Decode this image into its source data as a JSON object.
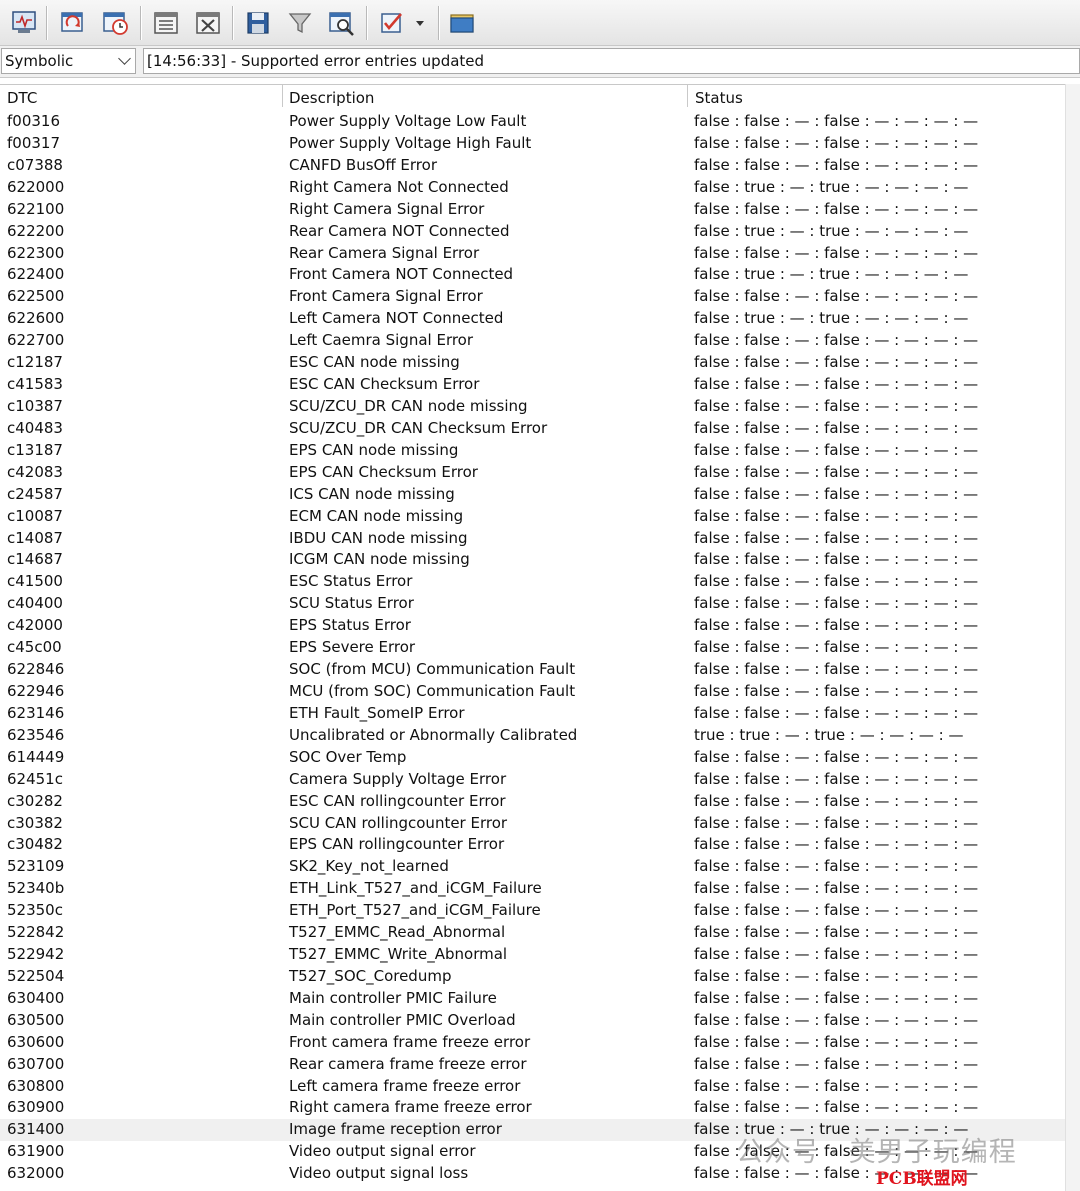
{
  "toolbar": {
    "buttons": [
      {
        "name": "display-icon"
      },
      {
        "name": "refresh-icon"
      },
      {
        "name": "refresh-clock-icon"
      },
      {
        "name": "list-icon"
      },
      {
        "name": "clear-list-icon"
      },
      {
        "name": "save-icon"
      },
      {
        "name": "filter-icon"
      },
      {
        "name": "search-window-icon"
      },
      {
        "name": "checklist-icon"
      },
      {
        "name": "folder-icon"
      }
    ]
  },
  "filter": {
    "mode_value": "Symbolic",
    "message": "[14:56:33] - Supported error entries updated"
  },
  "table": {
    "headers": {
      "dtc": "DTC",
      "description": "Description",
      "status": "Status"
    },
    "rows": [
      {
        "dtc": "f00316",
        "description": "Power Supply Voltage Low Fault",
        "status": "false : false : — : false : — : — : — : —"
      },
      {
        "dtc": "f00317",
        "description": "Power Supply Voltage High Fault",
        "status": "false : false : — : false : — : — : — : —"
      },
      {
        "dtc": "c07388",
        "description": "CANFD BusOff Error",
        "status": "false : false : — : false : — : — : — : —"
      },
      {
        "dtc": "622000",
        "description": "Right Camera Not Connected",
        "status": "false : true : — : true : — : — : — : —"
      },
      {
        "dtc": "622100",
        "description": "Right Camera Signal Error",
        "status": "false : false : — : false : — : — : — : —"
      },
      {
        "dtc": "622200",
        "description": "Rear Camera NOT Connected",
        "status": "false : true : — : true : — : — : — : —"
      },
      {
        "dtc": "622300",
        "description": "Rear Camera Signal Error",
        "status": "false : false : — : false : — : — : — : —"
      },
      {
        "dtc": "622400",
        "description": "Front Camera NOT Connected",
        "status": "false : true : — : true : — : — : — : —"
      },
      {
        "dtc": "622500",
        "description": "Front Camera Signal Error",
        "status": "false : false : — : false : — : — : — : —"
      },
      {
        "dtc": "622600",
        "description": "Left Camera NOT Connected",
        "status": "false : true : — : true : — : — : — : —"
      },
      {
        "dtc": "622700",
        "description": "Left Caemra Signal Error",
        "status": "false : false : — : false : — : — : — : —"
      },
      {
        "dtc": "c12187",
        "description": "ESC CAN node missing",
        "status": "false : false : — : false : — : — : — : —"
      },
      {
        "dtc": "c41583",
        "description": "ESC CAN Checksum Error",
        "status": "false : false : — : false : — : — : — : —"
      },
      {
        "dtc": "c10387",
        "description": "SCU/ZCU_DR CAN node missing",
        "status": "false : false : — : false : — : — : — : —"
      },
      {
        "dtc": "c40483",
        "description": "SCU/ZCU_DR CAN Checksum Error",
        "status": "false : false : — : false : — : — : — : —"
      },
      {
        "dtc": "c13187",
        "description": "EPS CAN node missing",
        "status": "false : false : — : false : — : — : — : —"
      },
      {
        "dtc": "c42083",
        "description": "EPS CAN Checksum Error",
        "status": "false : false : — : false : — : — : — : —"
      },
      {
        "dtc": "c24587",
        "description": "ICS CAN node missing",
        "status": "false : false : — : false : — : — : — : —"
      },
      {
        "dtc": "c10087",
        "description": "ECM CAN node missing",
        "status": "false : false : — : false : — : — : — : —"
      },
      {
        "dtc": "c14087",
        "description": "IBDU CAN node missing",
        "status": "false : false : — : false : — : — : — : —"
      },
      {
        "dtc": "c14687",
        "description": "ICGM CAN node missing",
        "status": "false : false : — : false : — : — : — : —"
      },
      {
        "dtc": "c41500",
        "description": "ESC Status Error",
        "status": "false : false : — : false : — : — : — : —"
      },
      {
        "dtc": "c40400",
        "description": "SCU Status Error",
        "status": "false : false : — : false : — : — : — : —"
      },
      {
        "dtc": "c42000",
        "description": "EPS Status Error",
        "status": "false : false : — : false : — : — : — : —"
      },
      {
        "dtc": "c45c00",
        "description": "EPS Severe Error",
        "status": "false : false : — : false : — : — : — : —"
      },
      {
        "dtc": "622846",
        "description": "SOC (from MCU) Communication Fault",
        "status": "false : false : — : false : — : — : — : —"
      },
      {
        "dtc": "622946",
        "description": "MCU (from SOC) Communication Fault",
        "status": "false : false : — : false : — : — : — : —"
      },
      {
        "dtc": "623146",
        "description": "ETH Fault_SomeIP Error",
        "status": "false : false : — : false : — : — : — : —"
      },
      {
        "dtc": "623546",
        "description": "Uncalibrated or Abnormally Calibrated",
        "status": "true : true : — : true : — : — : — : —"
      },
      {
        "dtc": "614449",
        "description": "SOC Over Temp",
        "status": "false : false : — : false : — : — : — : —"
      },
      {
        "dtc": "62451c",
        "description": "Camera  Supply Voltage Error",
        "status": "false : false : — : false : — : — : — : —"
      },
      {
        "dtc": "c30282",
        "description": "ESC CAN rollingcounter Error",
        "status": "false : false : — : false : — : — : — : —"
      },
      {
        "dtc": "c30382",
        "description": "SCU CAN rollingcounter Error",
        "status": "false : false : — : false : — : — : — : —"
      },
      {
        "dtc": "c30482",
        "description": "EPS CAN rollingcounter Error",
        "status": "false : false : — : false : — : — : — : —"
      },
      {
        "dtc": "523109",
        "description": "SK2_Key_not_learned",
        "status": "false : false : — : false : — : — : — : —"
      },
      {
        "dtc": "52340b",
        "description": "ETH_Link_T527_and_iCGM_Failure",
        "status": "false : false : — : false : — : — : — : —"
      },
      {
        "dtc": "52350c",
        "description": "ETH_Port_T527_and_iCGM_Failure",
        "status": "false : false : — : false : — : — : — : —"
      },
      {
        "dtc": "522842",
        "description": "T527_EMMC_Read_Abnormal",
        "status": "false : false : — : false : — : — : — : —"
      },
      {
        "dtc": "522942",
        "description": "T527_EMMC_Write_Abnormal",
        "status": "false : false : — : false : — : — : — : —"
      },
      {
        "dtc": "522504",
        "description": "T527_SOC_Coredump",
        "status": "false : false : — : false : — : — : — : —"
      },
      {
        "dtc": "630400",
        "description": "Main controller PMIC Failure",
        "status": "false : false : — : false : — : — : — : —"
      },
      {
        "dtc": "630500",
        "description": "Main controller PMIC Overload",
        "status": "false : false : — : false : — : — : — : —"
      },
      {
        "dtc": "630600",
        "description": "Front camera frame freeze error",
        "status": "false : false : — : false : — : — : — : —"
      },
      {
        "dtc": "630700",
        "description": "Rear camera frame freeze error",
        "status": "false : false : — : false : — : — : — : —"
      },
      {
        "dtc": "630800",
        "description": "Left camera frame freeze error",
        "status": "false : false : — : false : — : — : — : —"
      },
      {
        "dtc": "630900",
        "description": "Right camera frame freeze error",
        "status": "false : false : — : false : — : — : — : —"
      },
      {
        "dtc": "631400",
        "description": "Image frame reception error",
        "status": "false : true : — : true : — : — : — : —"
      },
      {
        "dtc": "631900",
        "description": " Video output signal error",
        "status": "false : false : — : false : — : — : — : —"
      },
      {
        "dtc": "632000",
        "description": " Video output signal loss",
        "status": "false : false : — : false : — : — : — : —"
      }
    ]
  },
  "watermark": {
    "text": "公众号 · 美男子玩编程",
    "brand": "PCB联盟网（Pcbbar.com）"
  }
}
